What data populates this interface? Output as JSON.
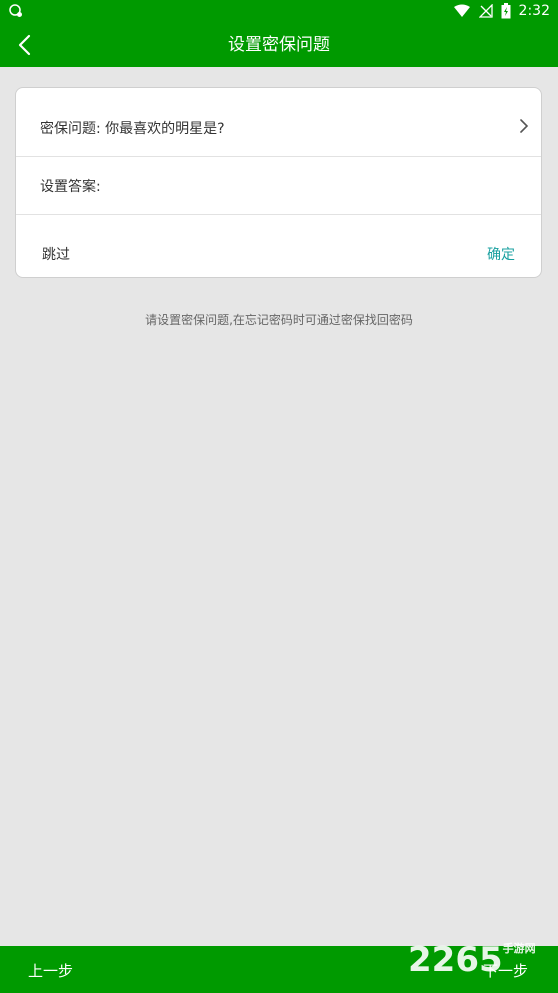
{
  "status_bar": {
    "time": "2:32",
    "icons": [
      "notification-icon",
      "wifi-icon",
      "no-signal-icon",
      "battery-icon"
    ]
  },
  "app_bar": {
    "title": "设置密保问题",
    "back_icon": "back-arrow-icon"
  },
  "form": {
    "question_label": "密保问题: 你最喜欢的明星是?",
    "answer_label": "设置答案:",
    "answer_value": "",
    "skip_label": "跳过",
    "confirm_label": "确定"
  },
  "hint": "请设置密保问题,在忘记密码时可通过密保找回密码",
  "footer": {
    "prev_label": "上一步",
    "next_label": "下一步"
  },
  "watermark": {
    "number": "2265",
    "subtitle": "手游网"
  },
  "colors": {
    "primary": "#009a00",
    "background": "#e6e6e6",
    "accent": "#1aa0a0"
  }
}
